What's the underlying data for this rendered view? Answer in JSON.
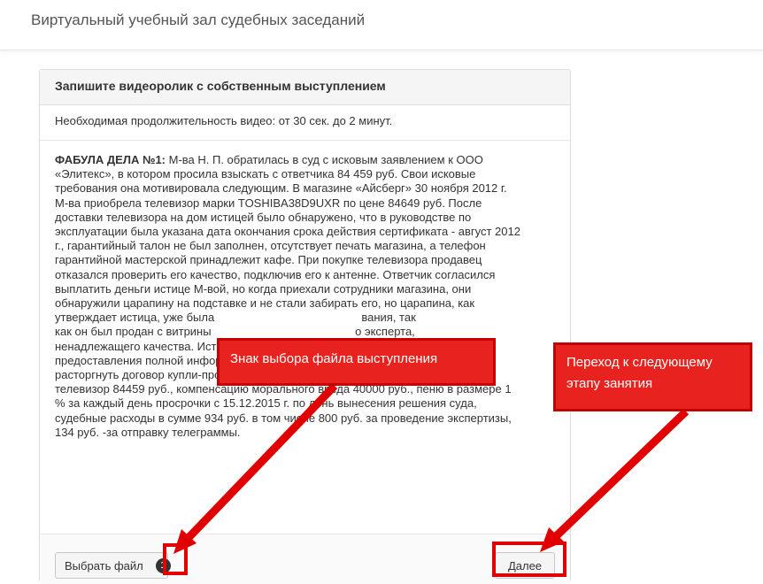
{
  "header": {
    "title": "Виртуальный учебный зал судебных заседаний"
  },
  "panel": {
    "heading": "Запишите видеоролик с собственным выступлением",
    "duration_note": "Необходимая продолжительность видео: от 30 сек. до 2 минут.",
    "case_label": "ФАБУЛА ДЕЛА №1:",
    "case_lines": [
      " М-ва Н. П. обратилась в суд с исковым заявлением к ООО",
      "«Элитекс», в котором просила взыскать с ответчика 84 459 руб. Свои исковые",
      "требования она мотивировала следующим. В магазине «Айсберг» 30 ноября 2012 г.",
      "М-ва приобрела телевизор марки TOSHIBA38D9UXR по цене 84649 руб. После",
      "доставки телевизора на дом истицей было обнаружено, что в руководстве по",
      "эксплуатации была указана дата окончания срока действия сертификата - август 2012",
      "г., гарантийный талон не был заполнен, отсутствует печать магазина, а телефон",
      "гарантийной мастерской принадлежит кафе. При покупке телевизора продавец",
      "отказался проверить его качество, подключив его к антенне. Ответчик согласился",
      "выплатить деньги истице М-вой, но когда приехали сотрудники магазина, они",
      "обнаружили царапину на подставке и не стали забирать его, но царапина, как",
      "утверждает истица, уже была                                              вания, так",
      "как он был продан с витрины                                             о эксперта,",
      "ненадлежащего качества. Истица считает, что ей был продан товар без",
      "предоставления полной информации о качестве проданного товара и просит суд",
      "расторгнуть договор купли-продажи, взыскать с ответчика уплаченную сумму за",
      "телевизор 84459 руб., компенсацию морального вреда 40000 руб., пеню в размере 1",
      "% за каждый день просрочки с 15.12.2015 г. по день вынесения решения суда,",
      "судебные расходы в сумме 934 руб. в том числе 800 руб. за проведение экспертизы,",
      "134 руб. -за отправку телеграммы."
    ]
  },
  "footer": {
    "choose_file_label": "Выбрать файл",
    "badge_count": "1",
    "next_label": "Далее"
  },
  "annotations": {
    "file_callout": "Знак выбора файла выступления",
    "next_callout_line1": "Переход к следующему",
    "next_callout_line2": "этапу занятия"
  },
  "colors": {
    "annotation_red": "#e00000"
  }
}
